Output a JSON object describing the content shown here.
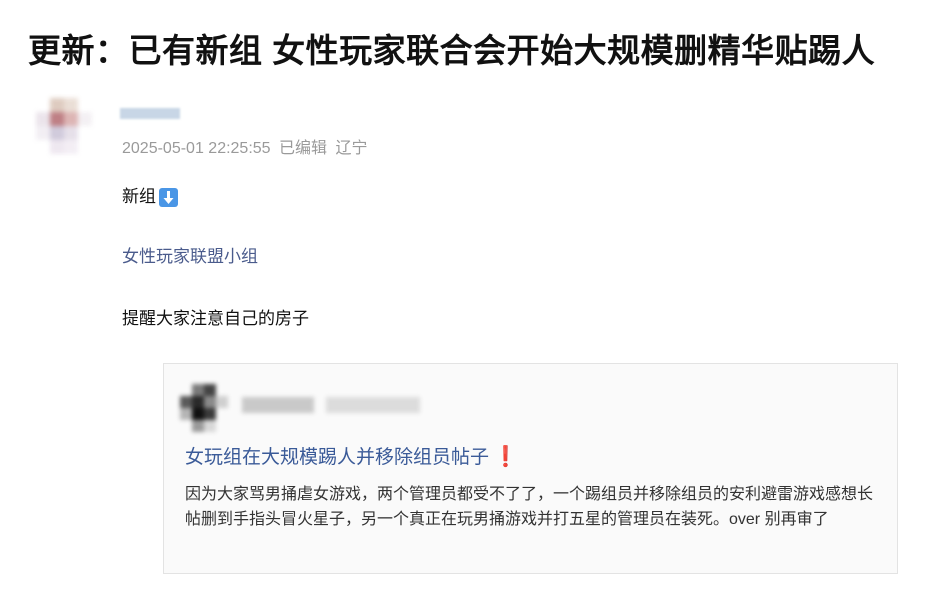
{
  "post": {
    "title": "更新：已有新组 女性玩家联合会开始大规模删精华贴踢人",
    "author": {
      "avatar": "avatar-blurred",
      "name": ""
    },
    "timestamp": "2025-05-01 22:25:55",
    "edited_label": "已编辑",
    "location": "辽宁",
    "content": {
      "new_group_label": "新组",
      "new_group_icon": "down-arrow-icon",
      "group_link_text": "女性玩家联盟小组",
      "reminder_text": "提醒大家注意自己的房子"
    }
  },
  "quote": {
    "avatar": "avatar-blurred",
    "title": "女玩组在大规模踢人并移除组员帖子",
    "title_icon": "exclamation-icon",
    "title_icon_glyph": "❗",
    "body": "因为大家骂男捅虐女游戏，两个管理员都受不了了，一个踢组员并移除组员的安利避雷游戏感想长帖删到手指头冒火星子，另一个真正在玩男捅游戏并打五星的管理员在装死。over 别再审了"
  },
  "colors": {
    "link": "#4a5b8c",
    "quote_title": "#3a5a98",
    "meta": "#9a9a9a",
    "icon_blue": "#4a96e6",
    "exclaim_red": "#e0245e"
  }
}
